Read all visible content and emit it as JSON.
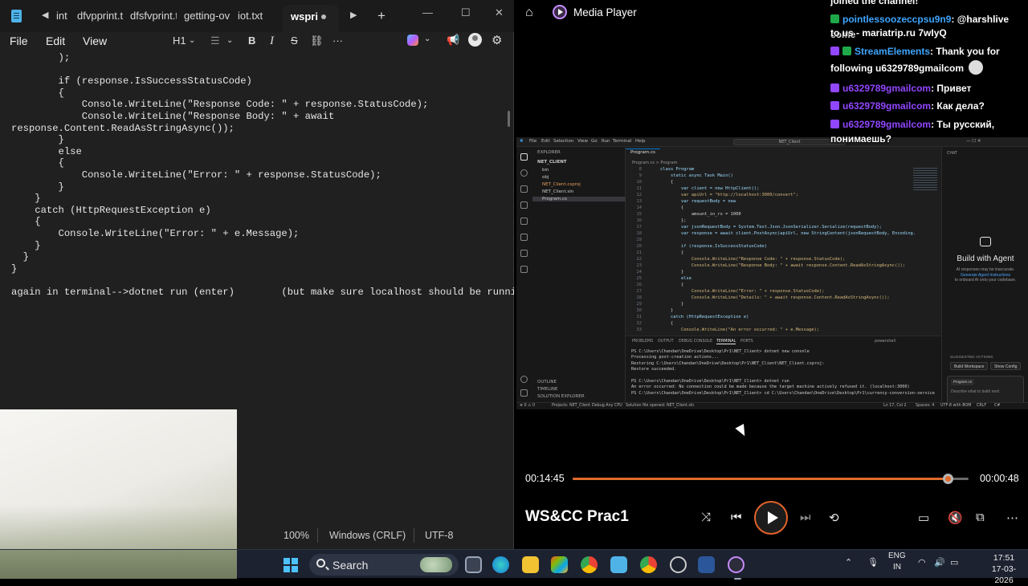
{
  "notepad": {
    "tabs": [
      "int",
      "dfvpprint.t",
      "dfsfvprint.t",
      "getting-ov",
      "iot.txt",
      "wspri"
    ],
    "active_tab": "wspri",
    "menu": {
      "file": "File",
      "edit": "Edit",
      "view": "View"
    },
    "toolbar": {
      "heading": "H1",
      "bold": "B",
      "italic": "I",
      "strike": "S"
    },
    "code_lines": [
      "        );",
      "",
      "        if (response.IsSuccessStatusCode)",
      "        {",
      "            Console.WriteLine(\"Response Code: \" + response.StatusCode);",
      "            Console.WriteLine(\"Response Body: \" + await",
      "response.Content.ReadAsStringAsync());",
      "        }",
      "        else",
      "        {",
      "            Console.WriteLine(\"Error: \" + response.StatusCode);",
      "        }",
      "    }",
      "    catch (HttpRequestException e)",
      "    {",
      "        Console.WriteLine(\"Error: \" + e.Message);",
      "    }",
      "  }",
      "}",
      "",
      "again in terminal-->dotnet run (enter)        (but make sure localhost should be running)"
    ],
    "status": {
      "zoom": "100%",
      "line_ending": "Windows (CRLF)",
      "encoding": "UTF-8"
    }
  },
  "player": {
    "app_title": "Media Player",
    "media_title": "WS&CC Prac1",
    "elapsed": "00:14:45",
    "remaining": "00:00:48",
    "progress_fraction": 0.948
  },
  "chat": {
    "lines": [
      {
        "text": "joined the channel!"
      },
      {
        "user": "pointlessoozeccpsu9n9",
        "msg": ": @harshlive come"
      },
      {
        "text": "to us - mariatrip.ru 7wIyQ"
      },
      {
        "user": "StreamElements",
        "msg": ": Thank you for"
      },
      {
        "text": "following u6329789gmailcom"
      },
      {
        "user": "u6329789gmailcom",
        "msg": ": Привет"
      },
      {
        "user": "u6329789gmailcom",
        "msg": ": Как дела?"
      },
      {
        "user": "u6329789gmailcom",
        "msg": ": Ты русский,"
      },
      {
        "text": "понимаешь?"
      }
    ]
  },
  "vscode": {
    "menu": [
      "File",
      "Edit",
      "Selection",
      "View",
      "Go",
      "Run",
      "Terminal",
      "Help"
    ],
    "search": "NET_Client",
    "explorer": {
      "title": "EXPLORER",
      "root": "NET_CLIENT",
      "items": [
        "bin",
        "obj",
        "NET_Client.csproj",
        "NET_Client.sln",
        "Program.cs"
      ],
      "bottom": [
        "OUTLINE",
        "TIMELINE",
        "SOLUTION EXPLORER"
      ]
    },
    "editor_tab": "Program.cs",
    "breadcrumb": "Program.cs > Program",
    "code": [
      {
        "n": "8",
        "t": "    class Program"
      },
      {
        "n": "9",
        "t": "        static async Task Main()"
      },
      {
        "n": "10",
        "t": "        {"
      },
      {
        "n": "11",
        "t": "            var client = new HttpClient();"
      },
      {
        "n": "12",
        "t": "            var apiUrl = \"http://localhost:3000/convert\";"
      },
      {
        "n": "13",
        "t": "            var requestBody = new"
      },
      {
        "n": "14",
        "t": "            {"
      },
      {
        "n": "15",
        "t": "                amount_in_rs = 1000"
      },
      {
        "n": "16",
        "t": "            };"
      },
      {
        "n": "17",
        "t": "            var jsonRequestBody = System.Text.Json.JsonSerializer.Serialize(requestBody);"
      },
      {
        "n": "18",
        "t": "            var response = await client.PostAsync(apiUrl, new StringContent(jsonRequestBody, Encoding."
      },
      {
        "n": "19",
        "t": ""
      },
      {
        "n": "20",
        "t": "            if (response.IsSuccessStatusCode)"
      },
      {
        "n": "21",
        "t": "            {"
      },
      {
        "n": "22",
        "t": "                Console.WriteLine(\"Response Code: \" + response.StatusCode);"
      },
      {
        "n": "23",
        "t": "                Console.WriteLine(\"Response Body: \" + await response.Content.ReadAsStringAsync());"
      },
      {
        "n": "24",
        "t": "            }"
      },
      {
        "n": "25",
        "t": "            else"
      },
      {
        "n": "26",
        "t": "            {"
      },
      {
        "n": "27",
        "t": "                Console.WriteLine(\"Error: \" + response.StatusCode);"
      },
      {
        "n": "28",
        "t": "                Console.WriteLine(\"Details: \" + await response.Content.ReadAsStringAsync());"
      },
      {
        "n": "29",
        "t": "            }"
      },
      {
        "n": "30",
        "t": "        }"
      },
      {
        "n": "31",
        "t": "        catch (HttpRequestException e)"
      },
      {
        "n": "32",
        "t": "        {"
      },
      {
        "n": "33",
        "t": "            Console.WriteLine(\"An error occurred: \" + e.Message);"
      }
    ],
    "panel_tabs": [
      "PROBLEMS",
      "OUTPUT",
      "DEBUG CONSOLE",
      "TERMINAL",
      "PORTS"
    ],
    "panel_active": "TERMINAL",
    "shell": "powershell",
    "terminal": [
      "PS C:\\Users\\Chandan\\OneDrive\\Desktop\\Pr1\\NET_Client> dotnet new console",
      "Processing post-creation actions...",
      "Restoring C:\\Users\\Chandan\\OneDrive\\Desktop\\Pr1\\NET_Client\\NET_Client.csproj:",
      "Restore succeeded.",
      "",
      "PS C:\\Users\\Chandan\\OneDrive\\Desktop\\Pr1\\NET_Client> dotnet run",
      "An error occurred: No connection could be made because the target machine actively refused it. (localhost:3000)",
      "PS C:\\Users\\Chandan\\OneDrive\\Desktop\\Pr1\\NET_Client> cd C:\\Users\\Chandan\\OneDrive\\Desktop\\Pr1\\currency-conversion-service"
    ],
    "chat_panel": {
      "header": "CHAT",
      "title": "Build with Agent",
      "subtitle": "AI responses may be inaccurate.",
      "link": "Generate Agent Instructions",
      "subtitle2": "to onboard AI onto your codebase.",
      "suggested": "SUGGESTED ACTIONS",
      "btn1": "Build Workspace",
      "btn2": "Show Config",
      "context": "Program.cs",
      "placeholder": "Describe what to build next"
    },
    "statusbar": {
      "left": "⊗ 0 ⚠ 0",
      "project": "Projects: NET_Client",
      "debug": "Debug Any CPU",
      "solution": "Solution file opened: NET_Client.sln",
      "pos": "Ln 17, Col 2",
      "spaces": "Spaces: 4",
      "enc": "UTF-8 with BOM",
      "eol": "CRLF",
      "lang": "C#"
    }
  },
  "taskbar": {
    "search_label": "Search",
    "lang_top": "ENG",
    "lang_bottom": "IN",
    "time": "17:51",
    "date": "17-03-2026"
  }
}
